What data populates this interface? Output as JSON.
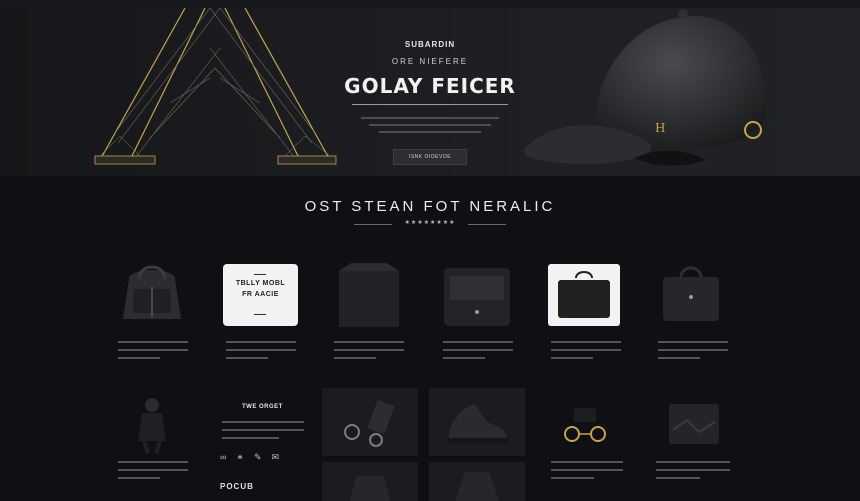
{
  "hero": {
    "eyebrow": "SUBARDIN",
    "subhead": "ORE NIEFERE",
    "title": "GOLAY FEICER",
    "description": "",
    "button_label": "ISNK OIOEVOE",
    "cap_logo": "H"
  },
  "section": {
    "title": "OST STEAN FOT NERALIC",
    "stars": "★★★★★★★★"
  },
  "products_row1": [
    {
      "name": "backpack",
      "label": ""
    },
    {
      "name": "white-tile",
      "label": "TBLLY MOBL\nFR AACIE"
    },
    {
      "name": "tote-bag",
      "label": ""
    },
    {
      "name": "messenger-bag",
      "label": ""
    },
    {
      "name": "laptop-bag",
      "label": ""
    },
    {
      "name": "handbag",
      "label": ""
    }
  ],
  "promo": {
    "heading": "TWE ORGET",
    "footer_label": "POCUB"
  },
  "colors": {
    "background": "#0e1013",
    "hero_bg": "#1d1f22",
    "accent_gold": "#c9a24a"
  }
}
